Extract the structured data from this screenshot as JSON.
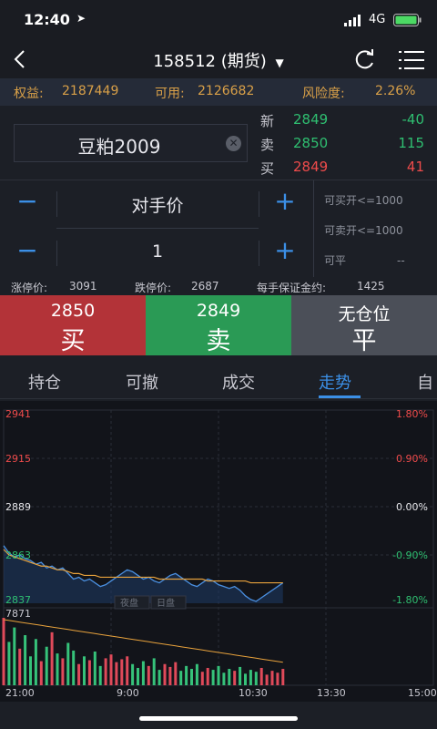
{
  "status_bar": {
    "time": "12:40",
    "network": "4G"
  },
  "nav": {
    "title": "158512 (期货)"
  },
  "account": {
    "equity_label": "权益:",
    "equity_value": "2187449",
    "available_label": "可用:",
    "available_value": "2126682",
    "risk_label": "风险度:",
    "risk_value": "2.26%"
  },
  "symbol": {
    "name": "豆粕2009"
  },
  "quotes": [
    {
      "label": "新",
      "price": "2849",
      "value": "-40",
      "price_color": "#2fbf71",
      "value_color": "#2fbf71"
    },
    {
      "label": "卖",
      "price": "2850",
      "value": "115",
      "price_color": "#2fbf71",
      "value_color": "#2fbf71"
    },
    {
      "label": "买",
      "price": "2849",
      "value": "41",
      "price_color": "#ef4b4b",
      "value_color": "#ef4b4b"
    }
  ],
  "order": {
    "price_type": "对手价",
    "quantity": "1"
  },
  "availability": {
    "buy_open_label": "可买开<=",
    "buy_open_value": "1000",
    "sell_open_label": "可卖开<=",
    "sell_open_value": "1000",
    "close_label": "可平",
    "close_value": "--"
  },
  "limits": {
    "up_label": "涨停价:",
    "up_value": "3091",
    "down_label": "跌停价:",
    "down_value": "2687",
    "margin_label": "每手保证金约:",
    "margin_value": "1425"
  },
  "trade_buttons": {
    "buy": {
      "price": "2850",
      "action": "买",
      "color": "#b33338"
    },
    "sell": {
      "price": "2849",
      "action": "卖",
      "color": "#2a9a55"
    },
    "close": {
      "price": "无仓位",
      "action": "平",
      "color": "#4b4f58"
    }
  },
  "tabs": [
    {
      "label": "持仓",
      "active": false
    },
    {
      "label": "可撤",
      "active": false
    },
    {
      "label": "成交",
      "active": false
    },
    {
      "label": "走势",
      "active": true
    },
    {
      "label": "自",
      "active": false
    }
  ],
  "chart_data": {
    "type": "line",
    "y_labels_left": [
      "2941",
      "2915",
      "2889",
      "2863",
      "2837"
    ],
    "y_labels_right": [
      "1.80%",
      "0.90%",
      "0.00%",
      "-0.90%",
      "-1.80%"
    ],
    "volume_label": "7871",
    "x_labels": [
      "21:00",
      "9:00",
      "10:30",
      "13:30",
      "15:00"
    ],
    "session_labels": [
      "夜盘",
      "日盘"
    ],
    "ylim": [
      2837,
      2941
    ],
    "price": [
      2868,
      2864,
      2862,
      2863,
      2861,
      2860,
      2858,
      2859,
      2856,
      2857,
      2855,
      2856,
      2853,
      2850,
      2851,
      2849,
      2850,
      2848,
      2846,
      2847,
      2849,
      2851,
      2853,
      2855,
      2854,
      2852,
      2850,
      2851,
      2849,
      2848,
      2850,
      2852,
      2853,
      2851,
      2849,
      2847,
      2846,
      2848,
      2850,
      2849,
      2847,
      2846,
      2845,
      2846,
      2844,
      2841,
      2839,
      2838,
      2840,
      2842,
      2844,
      2846,
      2848
    ],
    "avg": [
      2866,
      2863,
      2862,
      2861,
      2860,
      2859,
      2858,
      2857,
      2857,
      2856,
      2855,
      2855,
      2854,
      2853,
      2853,
      2852,
      2852,
      2852,
      2851,
      2851,
      2851,
      2851,
      2851,
      2851,
      2851,
      2851,
      2851,
      2851,
      2851,
      2850,
      2850,
      2850,
      2850,
      2850,
      2850,
      2850,
      2850,
      2850,
      2849,
      2849,
      2849,
      2849,
      2849,
      2849,
      2849,
      2849,
      2848,
      2848,
      2848,
      2848,
      2848,
      2848,
      2848
    ],
    "volume": [
      70,
      45,
      60,
      38,
      52,
      30,
      48,
      25,
      40,
      55,
      33,
      28,
      44,
      36,
      22,
      30,
      26,
      35,
      20,
      28,
      32,
      24,
      27,
      30,
      22,
      18,
      25,
      20,
      28,
      16,
      22,
      19,
      24,
      15,
      20,
      17,
      22,
      14,
      18,
      16,
      20,
      13,
      17,
      15,
      19,
      12,
      16,
      14,
      18,
      11,
      15,
      13,
      17
    ],
    "colors": {
      "price": "#4a8fe0",
      "avg": "#e8a23c",
      "up": "#e04a5a",
      "down": "#36c27a",
      "grid": "#2a2e38"
    }
  }
}
